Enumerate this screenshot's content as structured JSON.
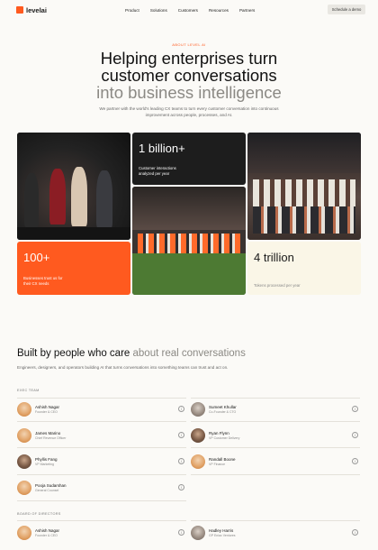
{
  "nav": {
    "brand": "levelai",
    "links": [
      "Product",
      "Solutions",
      "Customers",
      "Resources",
      "Partners"
    ],
    "cta": "Schedule a demo"
  },
  "hero": {
    "eyebrow": "ABOUT LEVEL AI",
    "headline_line1": "Helping enterprises turn",
    "headline_line2": "customer conversations",
    "headline_line3": "into business intelligence",
    "subhead": "We partner with the world's leading CX teams to turn every customer conversation into continuous improvement across people, processes, and AI."
  },
  "stats": {
    "interactions_value": "1 billion+",
    "interactions_label": "Customer interactions analyzed per year",
    "businesses_value": "100+",
    "businesses_label": "Businesses trust us for their CX needs",
    "tokens_value": "4 trillion",
    "tokens_label": "Tokens processed per year"
  },
  "team": {
    "title": "Built by people who care",
    "title_muted": "about real conversations",
    "subtitle": "Engineers, designers, and operators building AI that turns conversations into something teams can trust and act on.",
    "exec_label": "EXEC TEAM",
    "exec": [
      {
        "name": "Ashish Nagar",
        "role": "Founder & CEO"
      },
      {
        "name": "Sumeet Khullar",
        "role": "Co-Founder & CTO"
      },
      {
        "name": "James Marino",
        "role": "Chief Revenue Officer"
      },
      {
        "name": "Ryan Flynn",
        "role": "VP Customer Delivery"
      },
      {
        "name": "Phyllis Fang",
        "role": "VP Marketing"
      },
      {
        "name": "Randall Boone",
        "role": "VP Finance"
      },
      {
        "name": "Pooja Sudarshan",
        "role": "General Counsel"
      }
    ],
    "board_label": "BOARD OF DIRECTORS",
    "board": [
      {
        "name": "Ashish Nagar",
        "role": "Founder & CEO"
      },
      {
        "name": "Hadley Harris",
        "role": "GP Eniac Ventures"
      }
    ],
    "info_glyph": "i"
  },
  "colors": {
    "accent": "#ff5a1f",
    "dark_tile": "#1d1d1d",
    "cream_tile": "#faf6e7",
    "page_bg": "#fbfaf7"
  }
}
